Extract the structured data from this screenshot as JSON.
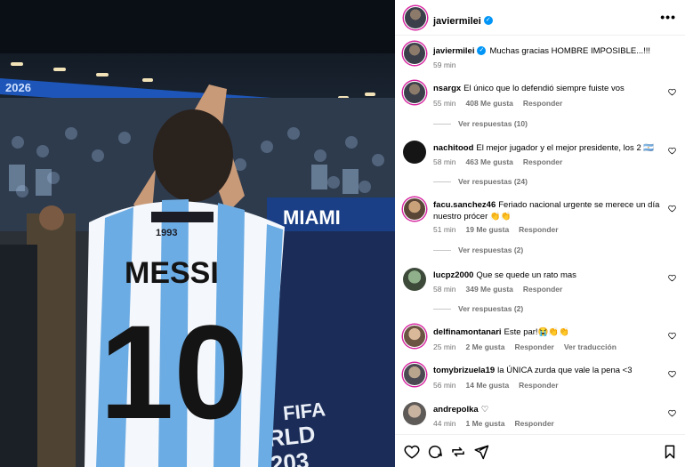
{
  "post": {
    "author": "javiermilei",
    "caption_user": "javiermilei",
    "caption_text": "Muchas gracias HOMBRE IMPOSIBLE...!!!",
    "caption_time": "59 min",
    "more_icon": "more-horizontal-icon"
  },
  "photo": {
    "jersey_name": "MESSI",
    "jersey_number": "10",
    "jersey_year": "1993",
    "stadium_sign": "MIAMI",
    "banner_year": "2026",
    "floor_text_1": "FIFA",
    "floor_text_2": "RLD",
    "floor_text_3": "203"
  },
  "comments": [
    {
      "user": "nsargx",
      "text": "El único que lo defendió siempre fuiste vos",
      "time": "55 min",
      "likes": "408 Me gusta",
      "reply": "Responder",
      "view_replies": "Ver respuestas (10)"
    },
    {
      "user": "nachitood",
      "text": "El mejor jugador y el mejor presidente, los 2 🇦🇷",
      "time": "58 min",
      "likes": "463 Me gusta",
      "reply": "Responder",
      "view_replies": "Ver respuestas (24)"
    },
    {
      "user": "facu.sanchez46",
      "text": "Feriado nacional urgente se merece un día nuestro prócer 👏👏",
      "time": "51 min",
      "likes": "19 Me gusta",
      "reply": "Responder",
      "view_replies": "Ver respuestas (2)"
    },
    {
      "user": "lucpz2000",
      "text": "Que se quede un rato mas",
      "time": "58 min",
      "likes": "349 Me gusta",
      "reply": "Responder",
      "view_replies": "Ver respuestas (2)"
    },
    {
      "user": "delfinamontanari",
      "text": "Este par!😭👏👏",
      "time": "25 min",
      "likes": "2 Me gusta",
      "reply": "Responder",
      "translate": "Ver traducción"
    },
    {
      "user": "tomybrizuela19",
      "text": "la ÚNICA zurda que vale la pena <3",
      "time": "56 min",
      "likes": "14 Me gusta",
      "reply": "Responder"
    },
    {
      "user": "andrepolka",
      "text": "♡",
      "time": "44 min",
      "likes": "1 Me gusta",
      "reply": "Responder"
    }
  ],
  "footer_icons": [
    "heart-icon",
    "comment-icon",
    "share-icon",
    "send-icon",
    "bookmark-icon"
  ],
  "colors": {
    "verified": "#0095f6",
    "meta_text": "#737373",
    "story_ring": "#d6249f",
    "jersey_blue": "#6cace4"
  }
}
